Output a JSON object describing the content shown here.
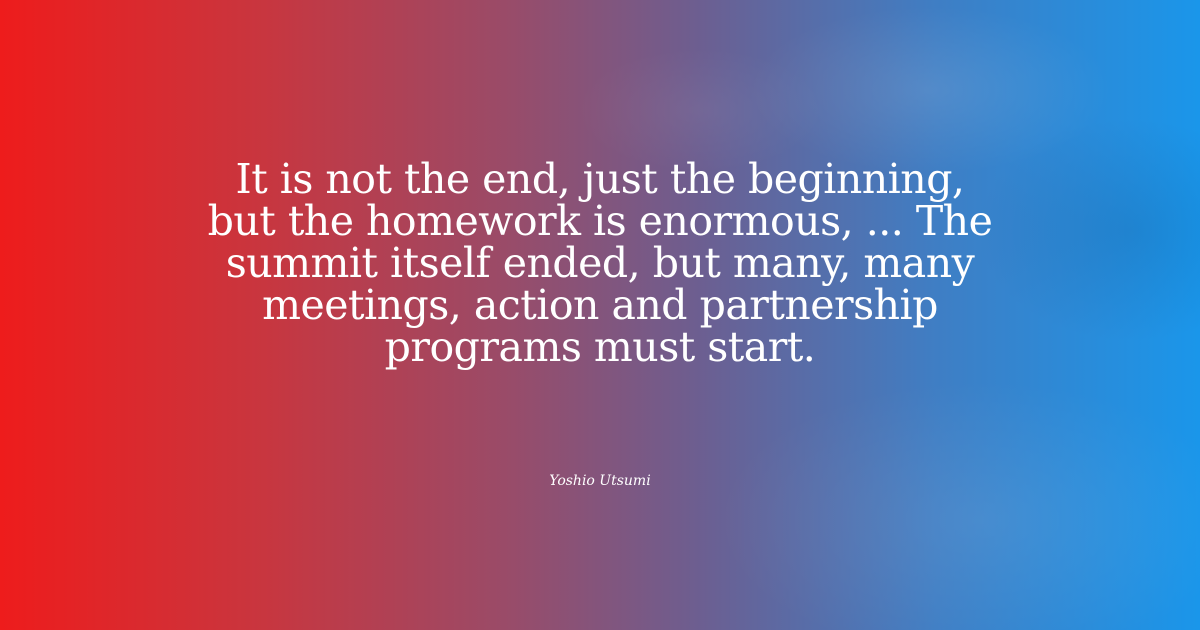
{
  "quote": {
    "text": "It is not the end, just the beginning, but the homework is enormous, ... The summit itself ended, but many, many meetings, action and partnership programs must start."
  },
  "author": {
    "name": "Yoshio Utsumi"
  },
  "colors": {
    "gradient_left": "#ee1c1c",
    "gradient_mid": "#9a4b68",
    "gradient_right": "#1a96ea",
    "text": "#ffffff"
  }
}
